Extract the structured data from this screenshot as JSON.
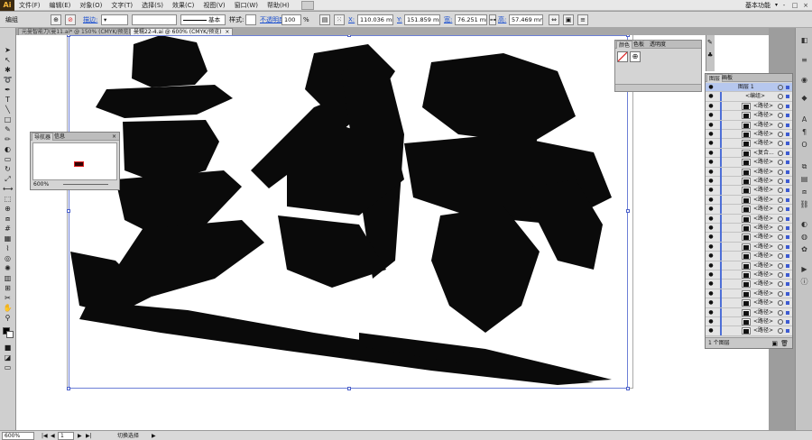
{
  "menubar": {
    "logo": "Ai",
    "items": [
      "文件(F)",
      "编辑(E)",
      "对象(O)",
      "文字(T)",
      "选择(S)",
      "效果(C)",
      "视图(V)",
      "窗口(W)",
      "帮助(H)"
    ],
    "workspace": "基本功能",
    "window_buttons": [
      "-",
      "□",
      "×"
    ]
  },
  "control": {
    "selection_label": "编组",
    "stroke_label": "描边:",
    "stroke_style": "基本",
    "style_label": "样式:",
    "opacity_label": "不透明度:",
    "opacity_value": "100",
    "percent": "%",
    "x_label": "X:",
    "x_value": "110.036 mm",
    "y_label": "Y:",
    "y_value": "151.859 mm",
    "w_label": "宽:",
    "w_value": "76.251 mm",
    "h_label": "高:",
    "h_value": "57.469 mm"
  },
  "tabs": [
    {
      "label": "元曼智能刀(曼11.ai* @ 150% (CMYK/预览)",
      "close": "×"
    },
    {
      "label": "曼糯22-4.ai @ 600% (CMYK/预览)",
      "close": "×"
    }
  ],
  "canvas": {
    "artwork_text": "曼糯",
    "artwork_desc": "black brush calligraphy"
  },
  "color_panel": {
    "tabs": [
      "颜色",
      "色板",
      "透明度"
    ]
  },
  "layers_panel": {
    "tabs": [
      "图层",
      "画板"
    ],
    "layer_name": "图层 1",
    "group_name": "<编组>",
    "rows": [
      "<路径>",
      "<路径>",
      "<路径>",
      "<路径>",
      "<路径>",
      "<复合...",
      "<路径>",
      "<路径>",
      "<路径>",
      "<路径>",
      "<路径>",
      "<路径>",
      "<路径>",
      "<路径>",
      "<路径>",
      "<路径>",
      "<路径>",
      "<路径>",
      "<路径>",
      "<路径>",
      "<路径>",
      "<路径>",
      "<路径>",
      "<路径>",
      "<路径>"
    ],
    "footer": "1 个图层"
  },
  "navigator": {
    "tabs": [
      "导航器",
      "信息"
    ],
    "zoom": "600%"
  },
  "statusbar": {
    "zoom": "600%",
    "artboard": "1",
    "tool_status": "切换选择"
  },
  "colors": {
    "accent": "#4e6fd7",
    "nav_red": "#e02020"
  }
}
